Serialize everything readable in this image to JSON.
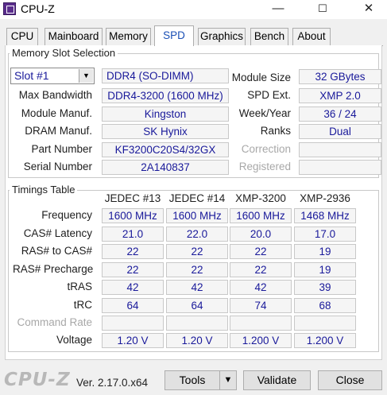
{
  "window": {
    "title": "CPU-Z",
    "minimize": "—",
    "maximize": "☐",
    "close": "✕"
  },
  "tabs": [
    {
      "label": "CPU"
    },
    {
      "label": "Mainboard"
    },
    {
      "label": "Memory"
    },
    {
      "label": "SPD",
      "active": true
    },
    {
      "label": "Graphics"
    },
    {
      "label": "Bench"
    },
    {
      "label": "About"
    }
  ],
  "slot": {
    "group_title": "Memory Slot Selection",
    "selected_slot": "Slot #1",
    "module_type": "DDR4 (SO-DIMM)",
    "fields_left": [
      {
        "label": "Max Bandwidth",
        "value": "DDR4-3200 (1600 MHz)"
      },
      {
        "label": "Module Manuf.",
        "value": "Kingston"
      },
      {
        "label": "DRAM Manuf.",
        "value": "SK Hynix"
      },
      {
        "label": "Part Number",
        "value": "KF3200C20S4/32GX"
      },
      {
        "label": "Serial Number",
        "value": "2A140837"
      }
    ],
    "fields_right": [
      {
        "label": "Module Size",
        "value": "32 GBytes",
        "enabled": true
      },
      {
        "label": "SPD Ext.",
        "value": "XMP 2.0",
        "enabled": true
      },
      {
        "label": "Week/Year",
        "value": "36 / 24",
        "enabled": true
      },
      {
        "label": "Ranks",
        "value": "Dual",
        "enabled": true
      },
      {
        "label": "Correction",
        "value": "",
        "enabled": false
      },
      {
        "label": "Registered",
        "value": "",
        "enabled": false
      }
    ]
  },
  "timings": {
    "group_title": "Timings Table",
    "columns": [
      "JEDEC #13",
      "JEDEC #14",
      "XMP-3200",
      "XMP-2936"
    ],
    "rows": [
      {
        "label": "Frequency",
        "values": [
          "1600 MHz",
          "1600 MHz",
          "1600 MHz",
          "1468 MHz"
        ]
      },
      {
        "label": "CAS# Latency",
        "values": [
          "21.0",
          "22.0",
          "20.0",
          "17.0"
        ]
      },
      {
        "label": "RAS# to CAS#",
        "values": [
          "22",
          "22",
          "22",
          "19"
        ]
      },
      {
        "label": "RAS# Precharge",
        "values": [
          "22",
          "22",
          "22",
          "19"
        ]
      },
      {
        "label": "tRAS",
        "values": [
          "42",
          "42",
          "42",
          "39"
        ]
      },
      {
        "label": "tRC",
        "values": [
          "64",
          "64",
          "74",
          "68"
        ]
      },
      {
        "label": "Command Rate",
        "values": [
          "",
          "",
          "",
          ""
        ],
        "disabled": true
      },
      {
        "label": "Voltage",
        "values": [
          "1.20 V",
          "1.20 V",
          "1.200 V",
          "1.200 V"
        ]
      }
    ]
  },
  "footer": {
    "logo": "CPU-Z",
    "version": "Ver. 2.17.0.x64",
    "tools_label": "Tools",
    "tools_arrow": "▼",
    "validate_label": "Validate",
    "close_label": "Close"
  },
  "icons": {
    "dropdown": "▼",
    "app": "cpu-z-icon"
  }
}
